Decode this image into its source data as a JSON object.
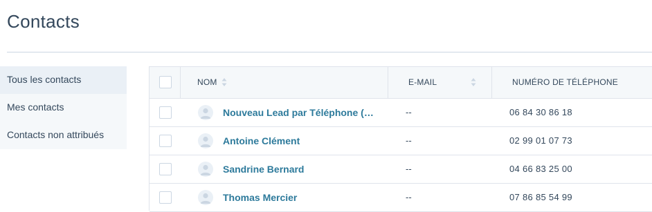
{
  "page": {
    "title": "Contacts"
  },
  "sidebar": {
    "items": [
      {
        "label": "Tous les contacts"
      },
      {
        "label": "Mes contacts"
      },
      {
        "label": "Contacts non attribués"
      }
    ]
  },
  "table": {
    "columns": {
      "name": "NOM",
      "email": "E-MAIL",
      "phone": "NUMÉRO DE TÉLÉPHONE"
    },
    "rows": [
      {
        "name": "Nouveau Lead par Téléphone (…",
        "email": "--",
        "phone": "06 84 30 86 18"
      },
      {
        "name": "Antoine Clément",
        "email": "--",
        "phone": "02 99 01 07 73"
      },
      {
        "name": "Sandrine Bernard",
        "email": "--",
        "phone": "04 66 83 25 00"
      },
      {
        "name": "Thomas Mercier",
        "email": "--",
        "phone": "07 86 85 54 99"
      }
    ]
  },
  "colors": {
    "link": "#2d7a9b",
    "text": "#33475b",
    "border": "#dfe3eb",
    "header_bg": "#f5f8fa"
  },
  "icons": [
    "sort-icon",
    "avatar-icon",
    "checkbox"
  ]
}
